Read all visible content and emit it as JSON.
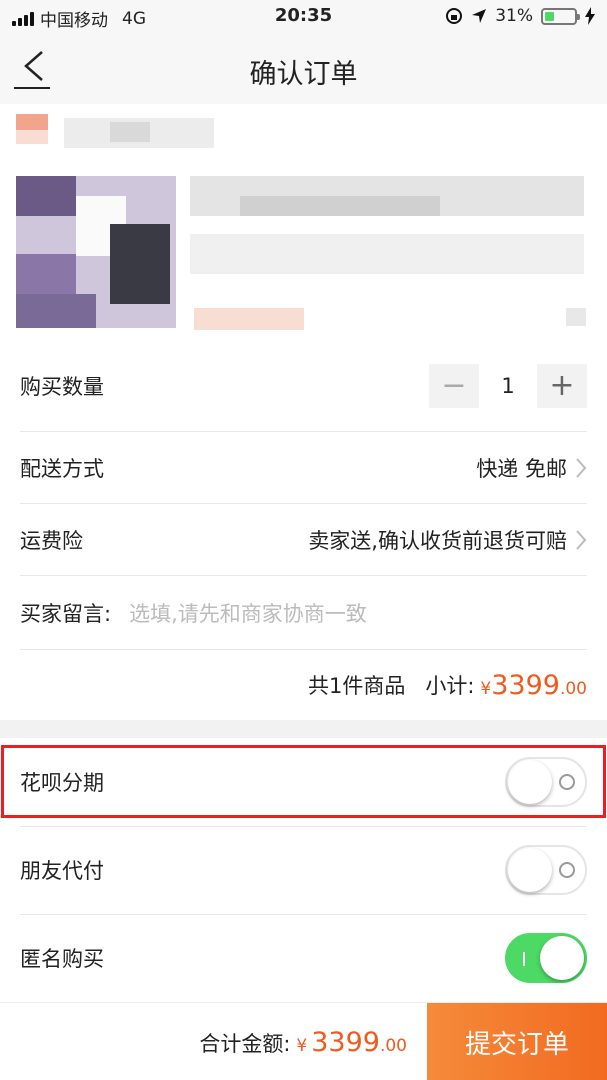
{
  "status_bar": {
    "carrier": "中国移动",
    "network": "4G",
    "time": "20:35",
    "battery": "31%",
    "battery_level": 0.31
  },
  "nav": {
    "title": "确认订单",
    "back_icon": "chevron-left-icon"
  },
  "order": {
    "quantity_label": "购买数量",
    "quantity_minus": "−",
    "quantity_value": "1",
    "quantity_plus": "+",
    "delivery_label": "配送方式",
    "delivery_value": "快递 免邮",
    "insurance_label": "运费险",
    "insurance_value": "卖家送,确认收货前退货可赔",
    "remark_label": "买家留言:",
    "remark_placeholder": "选填,请先和商家协商一致",
    "summary_count": "共1件商品",
    "summary_label": "小计:",
    "summary_currency": "¥",
    "summary_amount": "3399",
    "summary_decimals": ".00"
  },
  "options": [
    {
      "label": "花呗分期",
      "on": false
    },
    {
      "label": "朋友代付",
      "on": false
    },
    {
      "label": "匿名购买",
      "on": true
    }
  ],
  "footer": {
    "total_label": "合计金额:",
    "total_currency": "¥",
    "total_amount": "3399",
    "total_decimals": ".00",
    "submit_label": "提交订单"
  },
  "colors": {
    "accent": "#f05a1e",
    "submit": "#f26a20",
    "toggle_on": "#4cd964",
    "highlight": "#ee1c25"
  }
}
